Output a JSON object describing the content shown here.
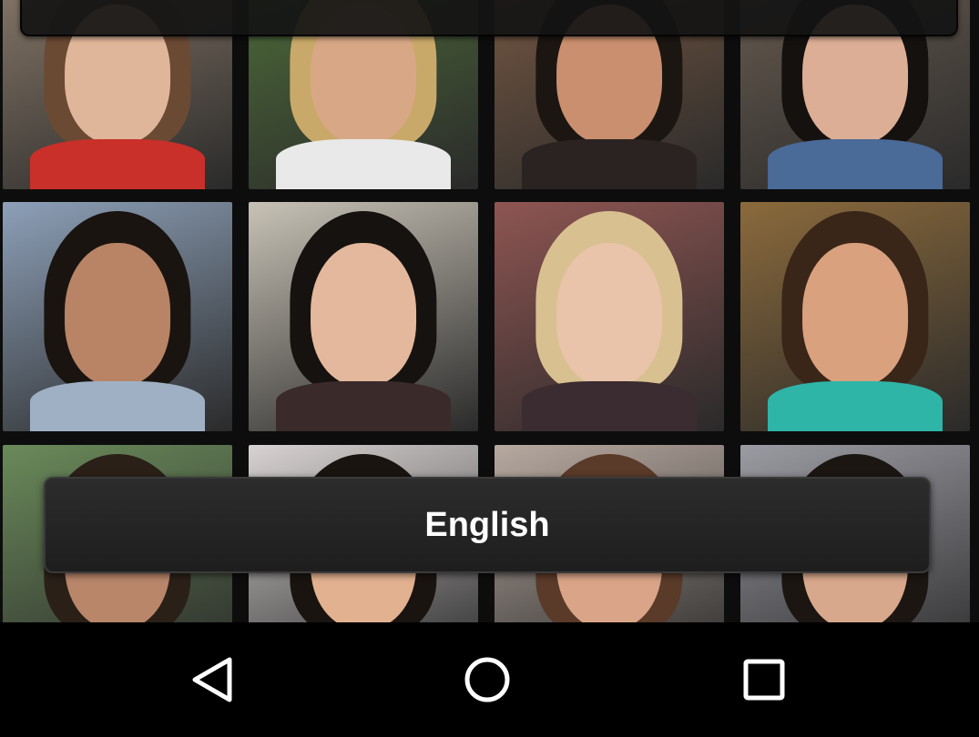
{
  "language_button": {
    "label": "English"
  },
  "photos": [
    {
      "bg": "#8a7a6a",
      "face": "#e0b69a",
      "hair": "#6b4a34",
      "shirt": "#c9302a"
    },
    {
      "bg": "#4f6e3a",
      "face": "#d8a886",
      "hair": "#c9a96a",
      "shirt": "#e9e9e9"
    },
    {
      "bg": "#7a5a44",
      "face": "#c98f6e",
      "hair": "#1c1612",
      "shirt": "#2b2222"
    },
    {
      "bg": "#6b5e52",
      "face": "#dcae96",
      "hair": "#15110f",
      "shirt": "#4a6a98"
    },
    {
      "bg": "#8da0b8",
      "face": "#b98466",
      "hair": "#1a1410",
      "shirt": "#9fb0c4"
    },
    {
      "bg": "#c8c2b6",
      "face": "#e3b89c",
      "hair": "#161210",
      "shirt": "#3a2a2a"
    },
    {
      "bg": "#8e5552",
      "face": "#e9c4aa",
      "hair": "#d8c090",
      "shirt": "#3a2c30"
    },
    {
      "bg": "#8b6a3c",
      "face": "#d9a17e",
      "hair": "#3a2618",
      "shirt": "#2eb5a8"
    },
    {
      "bg": "#6a8a5a",
      "face": "#b9866a",
      "hair": "#2a2018",
      "shirt": "#f1f1f1"
    },
    {
      "bg": "#d8d2d2",
      "face": "#e2b190",
      "hair": "#1a1410",
      "shirt": "#f4f4f4"
    },
    {
      "bg": "#b7a9a0",
      "face": "#d9a487",
      "hair": "#5a3a28",
      "shirt": "#3a98d8"
    },
    {
      "bg": "#9b9ba3",
      "face": "#d8a88c",
      "hair": "#1c1612",
      "shirt": "#e4e4e4"
    }
  ],
  "nav": {
    "back_icon": "back-triangle-icon",
    "home_icon": "home-circle-icon",
    "recents_icon": "recents-square-icon",
    "icon_color": "#ffffff"
  }
}
